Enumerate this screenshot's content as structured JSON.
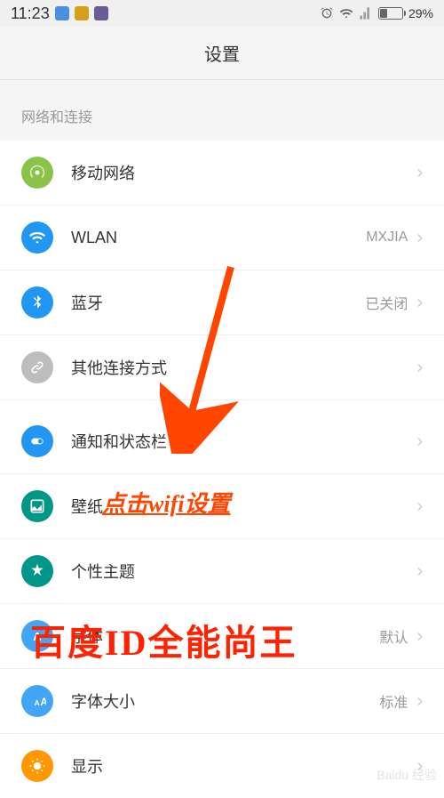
{
  "status": {
    "time": "11:23",
    "battery_pct": "29%"
  },
  "header": {
    "title": "设置"
  },
  "section_label": "网络和连接",
  "items": [
    {
      "label": "移动网络",
      "value": "",
      "icon_class": "icon-green",
      "icon": "signal"
    },
    {
      "label": "WLAN",
      "value": "MXJIA",
      "icon_class": "icon-blue",
      "icon": "wifi"
    },
    {
      "label": "蓝牙",
      "value": "已关闭",
      "icon_class": "icon-blue",
      "icon": "bluetooth"
    },
    {
      "label": "其他连接方式",
      "value": "",
      "icon_class": "icon-gray",
      "icon": "link"
    },
    {
      "label": "通知和状态栏",
      "value": "",
      "icon_class": "icon-blue",
      "icon": "toggle"
    },
    {
      "label": "壁纸",
      "value": "",
      "icon_class": "icon-teal",
      "icon": "image"
    },
    {
      "label": "个性主题",
      "value": "",
      "icon_class": "icon-teal",
      "icon": "theme"
    },
    {
      "label": "字体",
      "value": "默认",
      "icon_class": "icon-bluea",
      "icon": "font"
    },
    {
      "label": "字体大小",
      "value": "标准",
      "icon_class": "icon-bluea",
      "icon": "fontsize"
    },
    {
      "label": "显示",
      "value": "",
      "icon_class": "icon-orange",
      "icon": "display"
    }
  ],
  "annotations": {
    "a1": "点击wifi设置",
    "a2": "百度ID全能尚王"
  },
  "watermark": "Baidu 经验"
}
